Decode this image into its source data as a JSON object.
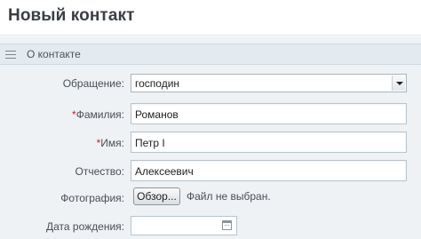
{
  "header": {
    "title": "Новый контакт"
  },
  "section": {
    "title": "О контакте"
  },
  "form": {
    "salutation": {
      "label": "Обращение:",
      "value": "господин"
    },
    "last_name": {
      "required_mark": "*",
      "label": "Фамилия:",
      "value": "Романов"
    },
    "first_name": {
      "required_mark": "*",
      "label": "Имя:",
      "value": "Петр I"
    },
    "middle_name": {
      "label": "Отчество:",
      "value": "Алексеевич"
    },
    "photo": {
      "label": "Фотография:",
      "button_label": "Обзор...",
      "status": "Файл не выбран."
    },
    "birth_date": {
      "label": "Дата рождения:",
      "value": ""
    }
  },
  "icons": {
    "menu": "hamburger-icon",
    "calendar": "calendar-icon",
    "dropdown": "chevron-down-icon"
  }
}
